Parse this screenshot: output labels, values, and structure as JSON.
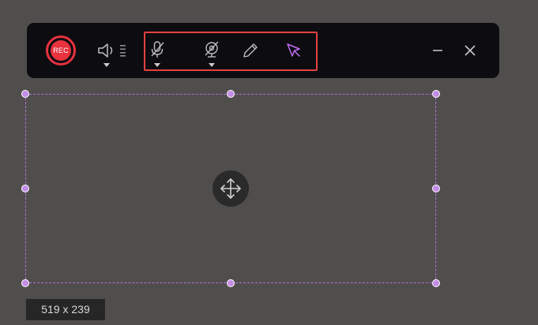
{
  "toolbar": {
    "rec_label": "REC",
    "icons": {
      "speaker": "speaker-icon",
      "volume_level": "volume-level-icon",
      "microphone_muted": "microphone-muted-icon",
      "webcam_off": "webcam-off-icon",
      "pen": "pen-icon",
      "cursor": "cursor-icon",
      "minimize": "minimize-icon",
      "close": "close-icon"
    }
  },
  "selection": {
    "size_label": "519 x 239"
  },
  "colors": {
    "background": "#4f4e4c",
    "toolbar": "#0d0c11",
    "rec": "#e8323e",
    "highlight": "#e4433f",
    "selection_border": "#b46ee3",
    "handle": "#c48ce9",
    "cursor_accent": "#c26ef5"
  }
}
